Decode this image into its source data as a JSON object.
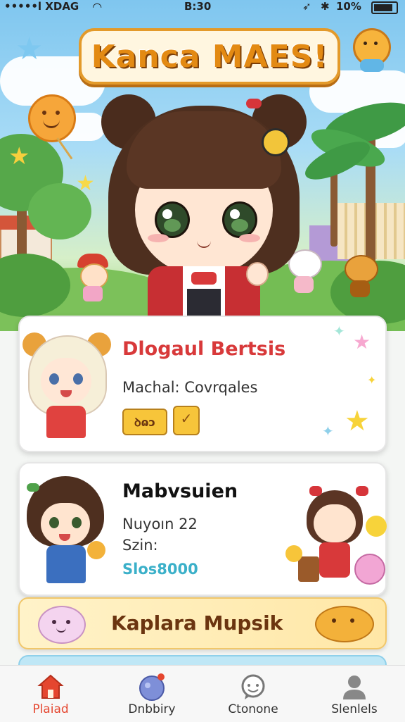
{
  "status_bar": {
    "carrier": "•••••l XDAG",
    "time": "B:30",
    "battery": "10%"
  },
  "app_title": "Kanca MAES!",
  "cards": [
    {
      "title": "Dlogaul Bertsis",
      "subtitle": "Machal: Covrqales",
      "badge_text": "ꝺɷɔ",
      "title_color": "#d8393a"
    },
    {
      "title": "Mabvsuien",
      "line1": "Nuyoın 22",
      "line2": "Szin:",
      "score": "Slos8000",
      "score_color": "#3bb0c9"
    }
  ],
  "banner": {
    "label": "Kaplara Mupsik"
  },
  "tabs": [
    {
      "label": "Plaiad",
      "icon": "home-icon",
      "active": true
    },
    {
      "label": "Dnbbiry",
      "icon": "globe-icon",
      "active": false
    },
    {
      "label": "Ctonone",
      "icon": "chat-icon",
      "active": false
    },
    {
      "label": "Slenlels",
      "icon": "person-icon",
      "active": false
    }
  ],
  "colors": {
    "accent_orange": "#e38a13",
    "active_tab": "#e5462f",
    "card_title_red": "#d8393a",
    "score_teal": "#3bb0c9"
  }
}
